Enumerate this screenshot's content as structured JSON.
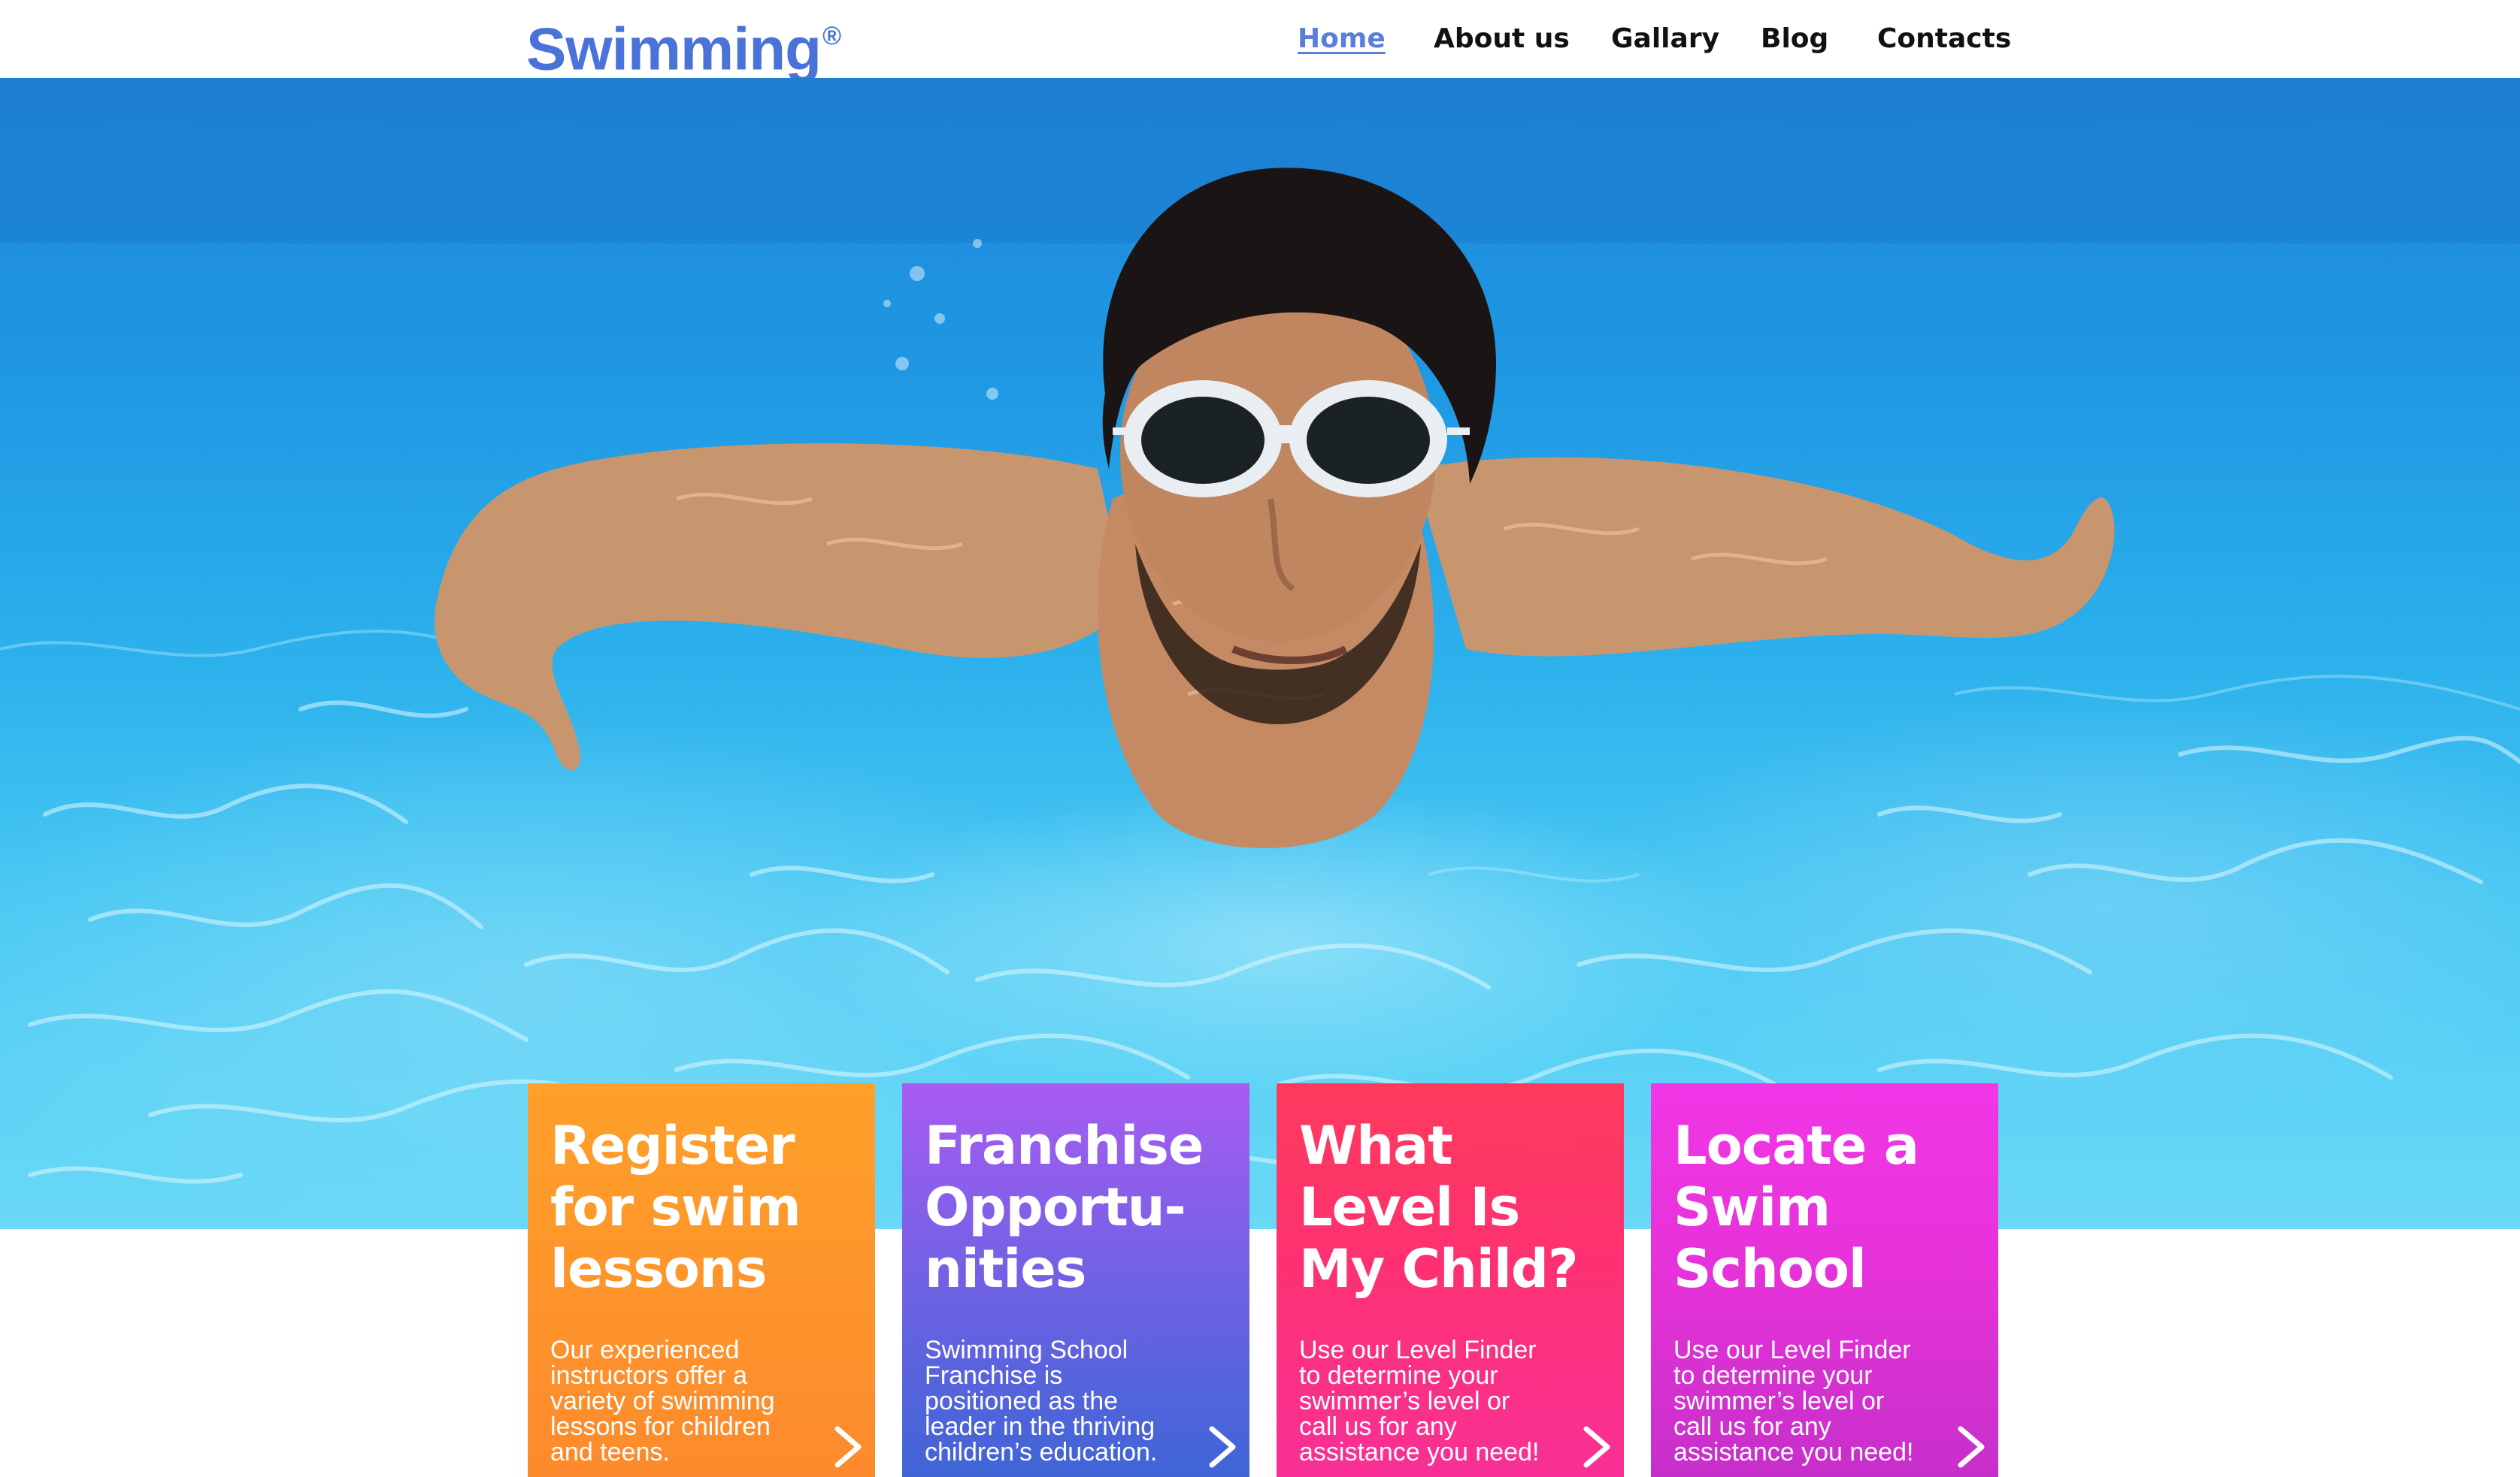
{
  "header": {
    "logo": "Swimming",
    "logo_mark": "®",
    "nav": [
      {
        "label": "Home",
        "active": true
      },
      {
        "label": "About us",
        "active": false
      },
      {
        "label": "Gallary",
        "active": false
      },
      {
        "label": "Blog",
        "active": false
      },
      {
        "label": "Contacts",
        "active": false
      }
    ]
  },
  "hero": {
    "image": "underwater-swimmer-with-goggles"
  },
  "cards": [
    {
      "title": "Register for swim lessons",
      "text": "Our experienced instructors offer a variety of swimming lessons for children and teens.",
      "icon": "chevron-right-icon",
      "color_top": "#fea02a",
      "color_bottom": "#fd8a2c"
    },
    {
      "title": "Franchise Opportu-nities",
      "text": "Swimming School Franchise is positioned as the leader in the thriving children’s education.",
      "icon": "chevron-right-icon",
      "color_top": "#a85cf2",
      "color_bottom": "#3f65d6"
    },
    {
      "title": "What Level Is My Child?",
      "text": "Use our Level Finder to determine your swimmer’s level or call us for any assistance you need!",
      "icon": "chevron-right-icon",
      "color_top": "#fe3a5c",
      "color_bottom": "#f83096"
    },
    {
      "title": "Locate a Swim School",
      "text": "Use our Level Finder to determine your swimmer’s level or call us for any assistance you need!",
      "icon": "chevron-right-icon",
      "color_top": "#f136e6",
      "color_bottom": "#c72fca"
    }
  ],
  "colors": {
    "brand": "#4a72d8",
    "nav_active": "#5a7fd9",
    "nav_text": "#111111"
  }
}
